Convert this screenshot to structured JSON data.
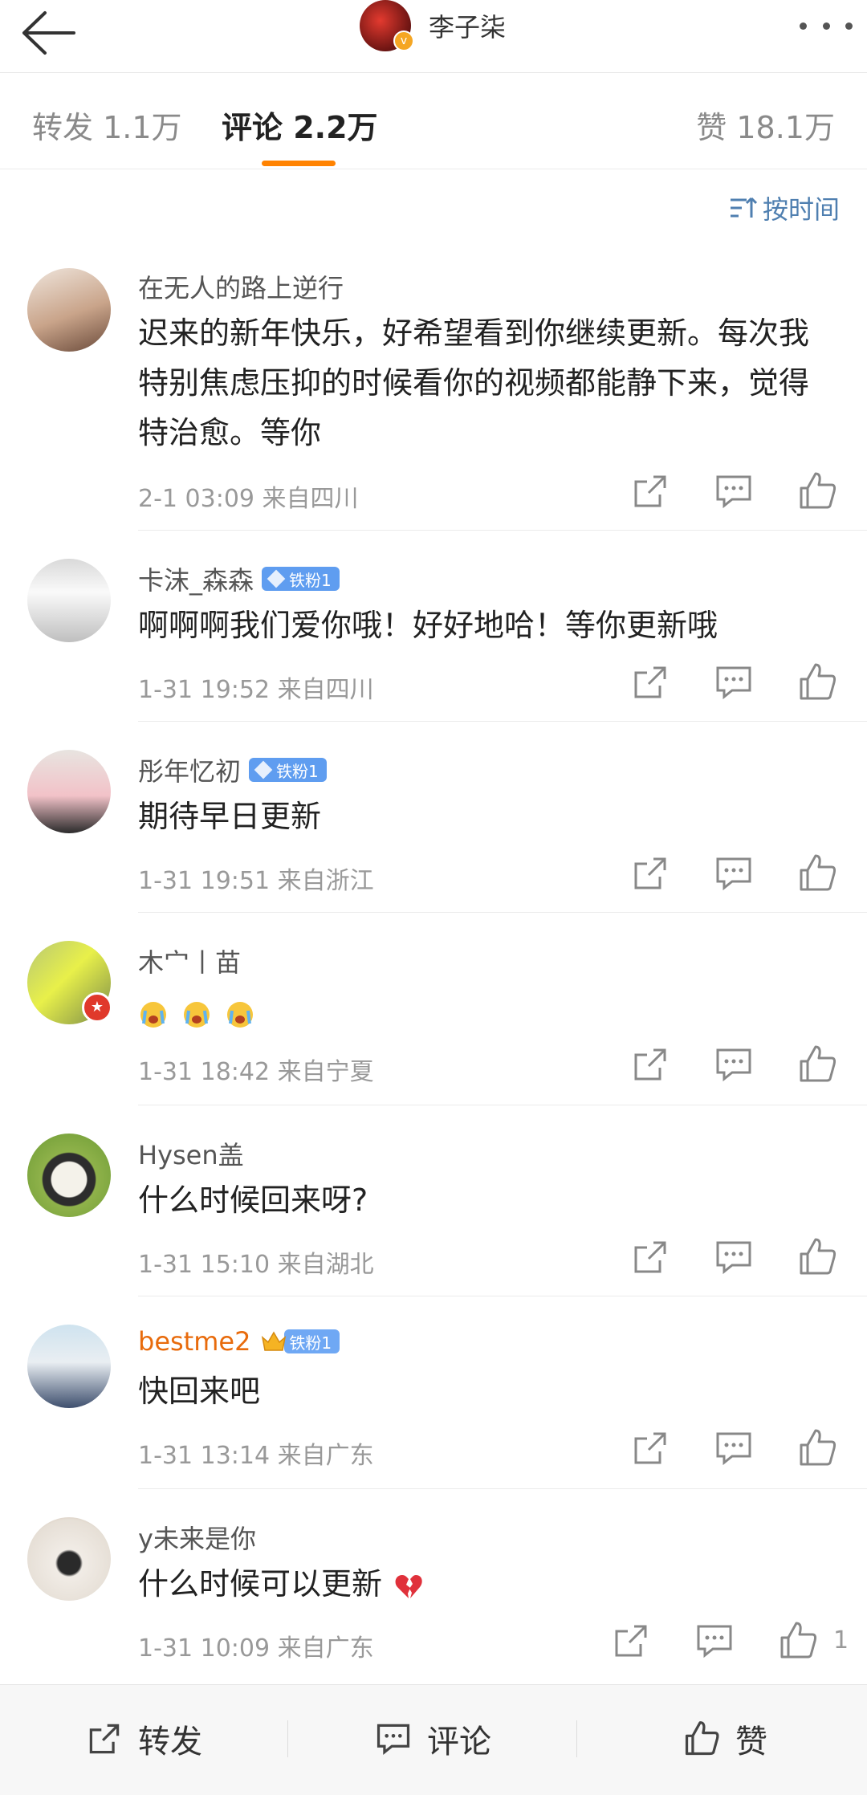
{
  "header": {
    "title": "李子柒",
    "back_icon": "arrow-left-icon",
    "more_icon": "more-dots-icon",
    "verified_badge": "v"
  },
  "tabs": [
    {
      "label": "转发 1.1万"
    },
    {
      "label": "评论 2.2万"
    },
    {
      "label": "赞 18.1万"
    }
  ],
  "sort": {
    "label": "按时间"
  },
  "comments": [
    {
      "user": "在无人的路上逆行",
      "text": "迟来的新年快乐，好希望看到你继续更新。每次我特别焦虑压抑的时候看你的视频都能静下来，觉得特治愈。等你",
      "meta": "2-1 03:09  来自四川"
    },
    {
      "user": "卡沫_森森",
      "badge": "铁粉1",
      "text": "啊啊啊我们爱你哦！好好地哈！等你更新哦",
      "meta": "1-31 19:52  来自四川"
    },
    {
      "user": "彤年忆初",
      "badge": "铁粉1",
      "text": "期待早日更新",
      "meta": "1-31 19:51  来自浙江"
    },
    {
      "user": "木宀丨苗",
      "text": "",
      "meta": "1-31 18:42  来自宁夏"
    },
    {
      "user": "Hysen盖",
      "text": "什么时候回来呀?",
      "meta": "1-31 15:10  来自湖北"
    },
    {
      "user": "bestme2",
      "badge": "铁粉1",
      "text": "快回来吧",
      "meta": "1-31 13:14  来自广东"
    },
    {
      "user": "y未来是你",
      "text": "什么时候可以更新",
      "meta": "1-31 10:09  来自广东",
      "like_count": "1"
    }
  ],
  "bottom_bar": {
    "repost": "转发",
    "comment": "评论",
    "like": "赞"
  },
  "colors": {
    "accent": "#ff8200",
    "link": "#4f7fb0",
    "badge": "#5f9df0",
    "vip_name": "#e86b0c"
  }
}
